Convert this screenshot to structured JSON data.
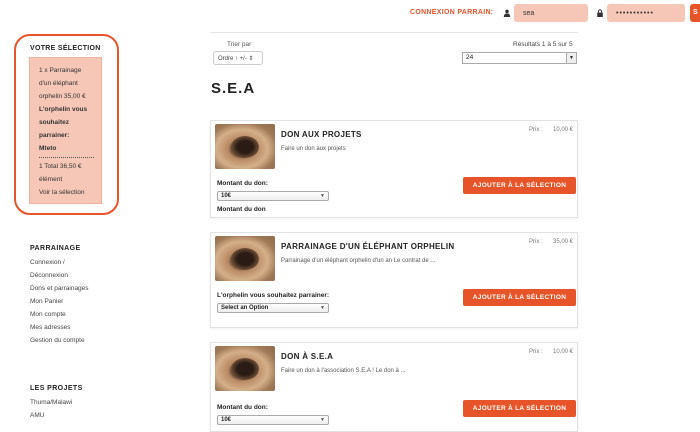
{
  "header": {
    "login_label": "CONNEXION PARRAIN:",
    "username_value": "sea",
    "password_value": "•••••••••••",
    "login_button_label": "S"
  },
  "selection": {
    "title": "VOTRE SÉLECTION",
    "item_line1": "1 x Parrainage",
    "item_line2": "d'un éléphant",
    "item_line3": "orphelin  35,00 €",
    "option_line1": "L'orphelin vous",
    "option_line2": "souhaitez",
    "option_line3": "parrainer:",
    "option_value": "Mteto",
    "count_line": "1    Total 36,50 €",
    "count_unit": "élément",
    "view_link": "Voir la sélection"
  },
  "nav": {
    "parrainage_title": "PARRAINAGE",
    "parrainage_links": [
      "Connexion /",
      "Déconnexion",
      "Dons et parrainages",
      "Mon Panier",
      "Mon compte",
      "Mes adresses",
      "Gestion du compte"
    ],
    "projets_title": "LES PROJETS",
    "projets_links": [
      "Thuma/Malawi",
      "AMU"
    ]
  },
  "listing": {
    "sort_label": "Trier par",
    "sort_value": "Ordre ↑ +/- ⇕",
    "results_info": "Résultats 1 à 5 sur 5",
    "per_page_value": "24",
    "page_title": "S.E.A"
  },
  "products": [
    {
      "title": "DON AUX PROJETS",
      "description": "Faire un don aux projets",
      "price_label": "Prix :",
      "price": "10,00 €",
      "field_label": "Montant du don:",
      "select_value": "10€",
      "extra_label": "Montant du don",
      "button_label": "AJOUTER À LA SÉLECTION"
    },
    {
      "title": "PARRAINAGE D'UN ÉLÉPHANT ORPHELIN",
      "description": "Parrainage d'un éléphant orphelin d'un an Le contrat de ...",
      "price_label": "Prix :",
      "price": "35,00 €",
      "field_label": "L'orphelin vous souhaitez parrainer:",
      "select_value": "Select an Option",
      "button_label": "AJOUTER À LA SÉLECTION"
    },
    {
      "title": "DON À S.E.A",
      "description": "Faire un don à l'association S.E.A ! Le don à ...",
      "price_label": "Prix :",
      "price": "10,00 €",
      "field_label": "Montant du don:",
      "select_value": "10€",
      "button_label": "AJOUTER À LA SÉLECTION"
    }
  ],
  "colors": {
    "accent": "#e8542a",
    "selection_bg": "#f6c7b6"
  }
}
